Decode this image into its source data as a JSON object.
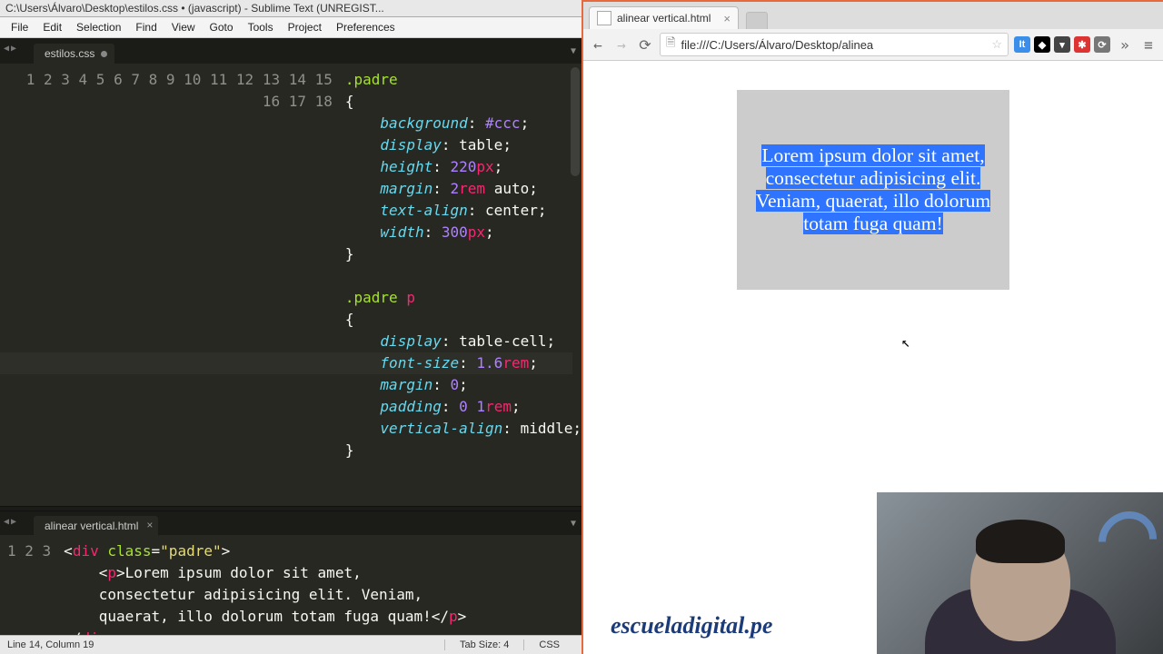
{
  "editor": {
    "title_path": "C:\\Users\\Álvaro\\Desktop\\estilos.css • (javascript) - Sublime Text (UNREGIST...",
    "menu": [
      "File",
      "Edit",
      "Selection",
      "Find",
      "View",
      "Goto",
      "Tools",
      "Project",
      "Preferences"
    ],
    "tab1": {
      "name": "estilos.css",
      "dirty": true
    },
    "tab2": {
      "name": "alinear vertical.html",
      "dirty": false
    },
    "status": {
      "pos": "Line 14, Column 19",
      "tab": "Tab Size: 4",
      "lang": "CSS"
    },
    "css_lines": [
      {
        "n": 1,
        "html": "<span class='sel'>.padre</span>"
      },
      {
        "n": 2,
        "html": "<span class='brace'>{</span>"
      },
      {
        "n": 3,
        "html": "    <span class='prop'>background</span><span class='punc'>:</span> <span class='num'>#ccc</span><span class='punc'>;</span>"
      },
      {
        "n": 4,
        "html": "    <span class='prop'>display</span><span class='punc'>:</span> <span class='val'>table</span><span class='punc'>;</span>"
      },
      {
        "n": 5,
        "html": "    <span class='prop'>height</span><span class='punc'>:</span> <span class='num'>220</span><span class='unit'>px</span><span class='punc'>;</span>"
      },
      {
        "n": 6,
        "html": "    <span class='prop'>margin</span><span class='punc'>:</span> <span class='num'>2</span><span class='unit'>rem</span> <span class='val'>auto</span><span class='punc'>;</span>"
      },
      {
        "n": 7,
        "html": "    <span class='prop'>text-align</span><span class='punc'>:</span> <span class='val'>center</span><span class='punc'>;</span>"
      },
      {
        "n": 8,
        "html": "    <span class='prop'>width</span><span class='punc'>:</span> <span class='num'>300</span><span class='unit'>px</span><span class='punc'>;</span>"
      },
      {
        "n": 9,
        "html": "<span class='brace'>}</span>"
      },
      {
        "n": 10,
        "html": ""
      },
      {
        "n": 11,
        "html": "<span class='sel'>.padre</span> <span class='tagsel'>p</span>"
      },
      {
        "n": 12,
        "html": "<span class='brace'>{</span>"
      },
      {
        "n": 13,
        "html": "    <span class='prop'>display</span><span class='punc'>:</span> <span class='val'>table-cell</span><span class='punc'>;</span>"
      },
      {
        "n": 14,
        "html": "    <span class='prop'>font-size</span><span class='punc'>:</span> <span class='num'>1.6</span><span class='unit'>rem</span><span class='punc'>;</span>"
      },
      {
        "n": 15,
        "html": "    <span class='prop'>margin</span><span class='punc'>:</span> <span class='num'>0</span><span class='punc'>;</span>"
      },
      {
        "n": 16,
        "html": "    <span class='prop'>padding</span><span class='punc'>:</span> <span class='num'>0</span> <span class='num'>1</span><span class='unit'>rem</span><span class='punc'>;</span>"
      },
      {
        "n": 17,
        "html": "    <span class='prop'>vertical-align</span><span class='punc'>:</span> <span class='val'>middle</span><span class='punc'>;</span>"
      },
      {
        "n": 18,
        "html": "<span class='brace'>}</span>"
      }
    ],
    "html_lines": [
      {
        "n": 1,
        "html": "<span class='ang'>&lt;</span><span class='tag'>div</span> <span class='attr'>class</span><span class='punc'>=</span><span class='str'>\"padre\"</span><span class='ang'>&gt;</span>"
      },
      {
        "n": 2,
        "html": "    <span class='ang'>&lt;</span><span class='tag'>p</span><span class='ang'>&gt;</span>Lorem ipsum dolor sit amet,\n    consectetur adipisicing elit. Veniam,\n    quaerat, illo dolorum totam fuga quam!<span class='ang'>&lt;/</span><span class='tag'>p</span><span class='ang'>&gt;</span>"
      },
      {
        "n": 3,
        "html": "<span class='ang'>&lt;/</span><span class='tag'>div</span><span class='ang'>&gt;</span>"
      }
    ],
    "highlight_line": 14
  },
  "browser": {
    "tab_title": "alinear vertical.html",
    "url": "file:///C:/Users/Álvaro/Desktop/alinea",
    "extensions": [
      {
        "bg": "#3b8fea",
        "txt": "It"
      },
      {
        "bg": "#000",
        "txt": "◆"
      },
      {
        "bg": "#444",
        "txt": "▾"
      },
      {
        "bg": "#d33",
        "txt": "✱"
      },
      {
        "bg": "#777",
        "txt": "⟳"
      }
    ],
    "paragraph": "Lorem ipsum dolor sit amet, consectetur adipisicing elit. Veniam, quaerat, illo dolorum totam fuga quam!",
    "brand": "escueladigital.pe"
  }
}
